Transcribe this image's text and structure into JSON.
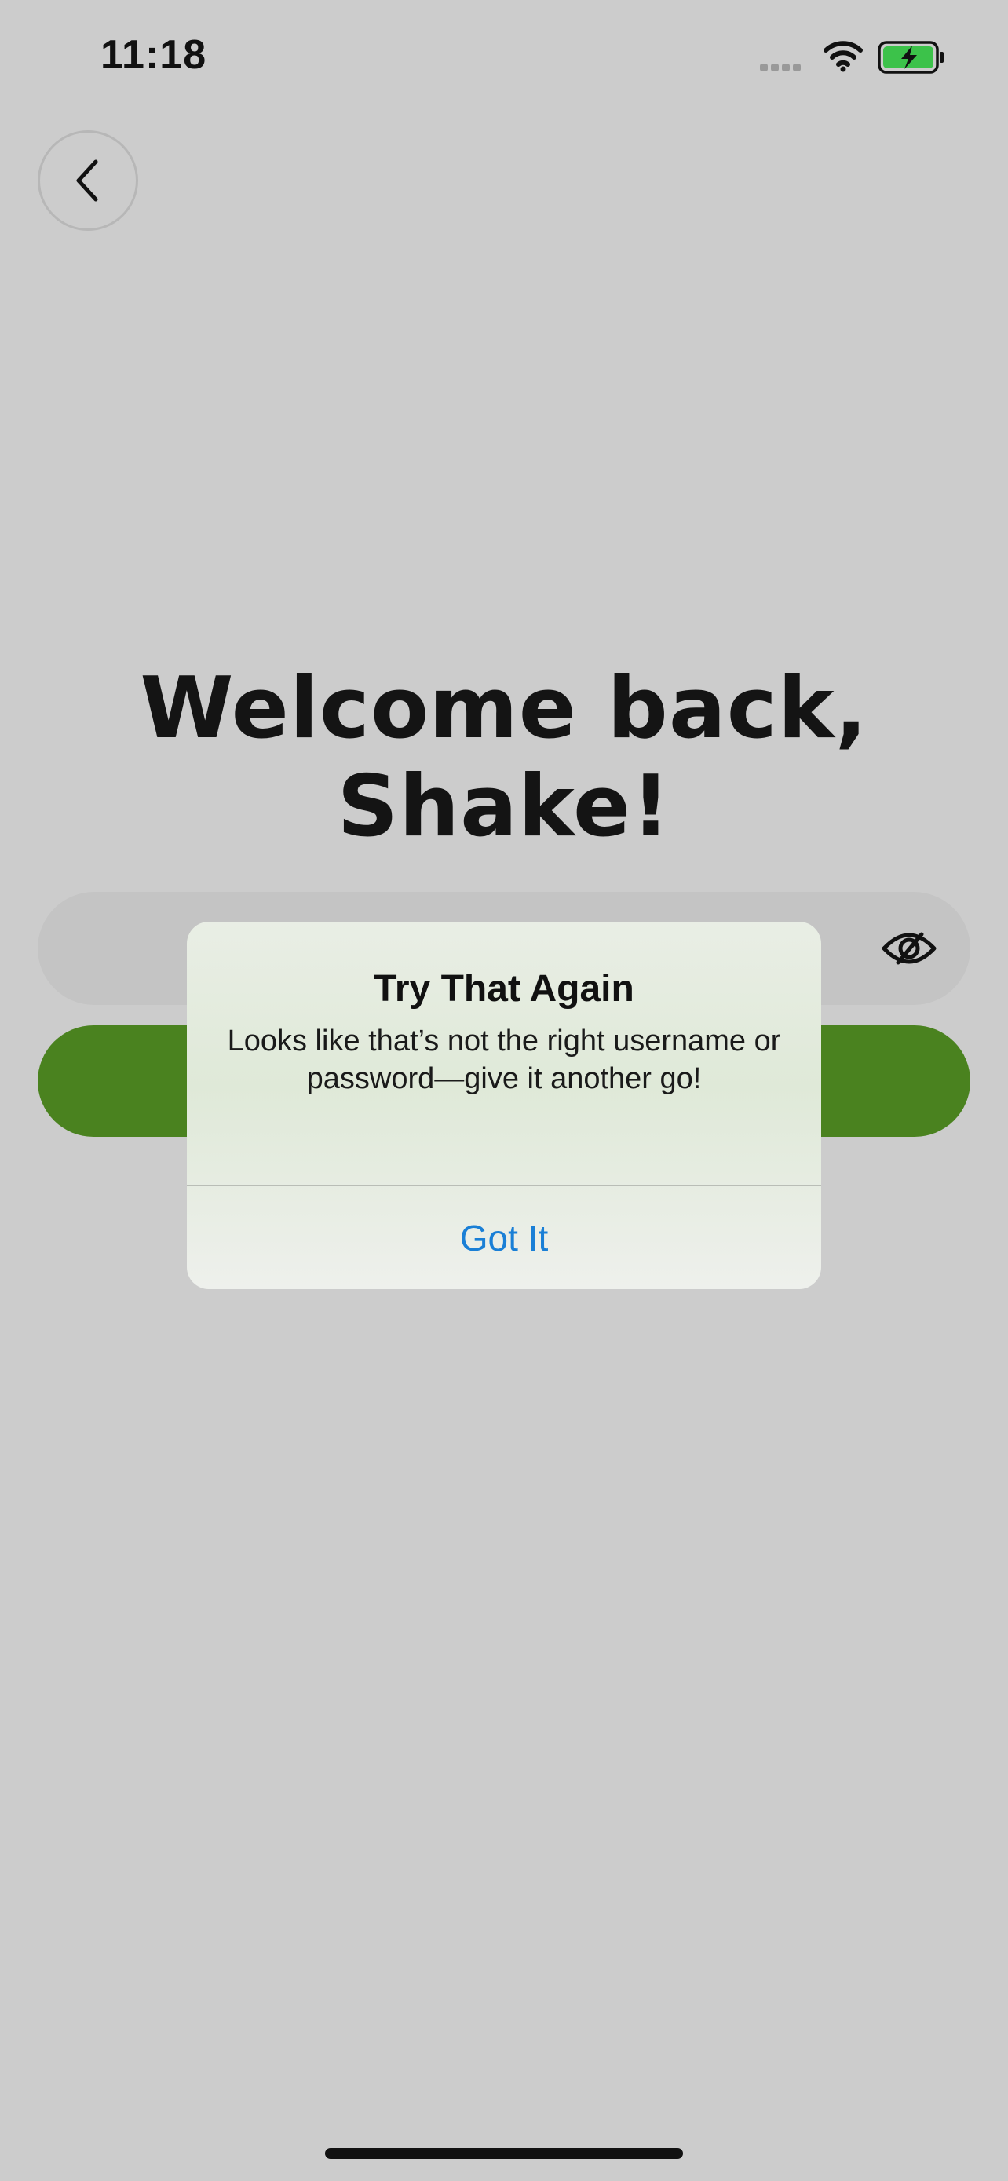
{
  "status_bar": {
    "time": "11:18",
    "icons": [
      "signal-dots-icon",
      "wifi-icon",
      "battery-charging-icon"
    ],
    "battery_color": "#3cc24a"
  },
  "nav": {
    "back_icon": "chevron-left-icon"
  },
  "welcome": {
    "title": "Welcome back, Shake!"
  },
  "form": {
    "password_toggle_icon": "eye-slash-icon",
    "login_button_color": "#4a821f"
  },
  "alert": {
    "title": "Try That Again",
    "message": "Looks like that’s not the right username or password—give it another go!",
    "button_label": "Got It",
    "button_color": "#1a7fd6"
  }
}
